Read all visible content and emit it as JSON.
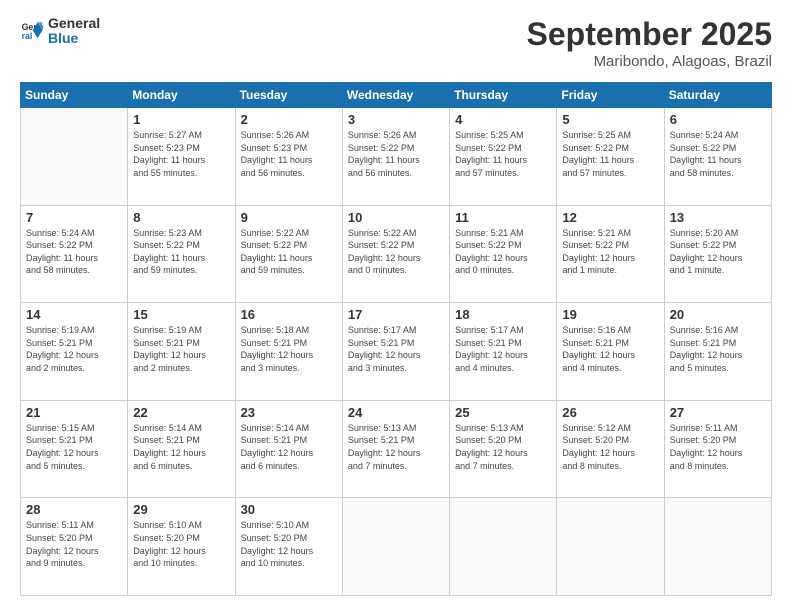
{
  "logo": {
    "line1": "General",
    "line2": "Blue"
  },
  "title": "September 2025",
  "location": "Maribondo, Alagoas, Brazil",
  "days_header": [
    "Sunday",
    "Monday",
    "Tuesday",
    "Wednesday",
    "Thursday",
    "Friday",
    "Saturday"
  ],
  "weeks": [
    [
      {
        "day": "",
        "info": ""
      },
      {
        "day": "1",
        "info": "Sunrise: 5:27 AM\nSunset: 5:23 PM\nDaylight: 11 hours\nand 55 minutes."
      },
      {
        "day": "2",
        "info": "Sunrise: 5:26 AM\nSunset: 5:23 PM\nDaylight: 11 hours\nand 56 minutes."
      },
      {
        "day": "3",
        "info": "Sunrise: 5:26 AM\nSunset: 5:22 PM\nDaylight: 11 hours\nand 56 minutes."
      },
      {
        "day": "4",
        "info": "Sunrise: 5:25 AM\nSunset: 5:22 PM\nDaylight: 11 hours\nand 57 minutes."
      },
      {
        "day": "5",
        "info": "Sunrise: 5:25 AM\nSunset: 5:22 PM\nDaylight: 11 hours\nand 57 minutes."
      },
      {
        "day": "6",
        "info": "Sunrise: 5:24 AM\nSunset: 5:22 PM\nDaylight: 11 hours\nand 58 minutes."
      }
    ],
    [
      {
        "day": "7",
        "info": "Sunrise: 5:24 AM\nSunset: 5:22 PM\nDaylight: 11 hours\nand 58 minutes."
      },
      {
        "day": "8",
        "info": "Sunrise: 5:23 AM\nSunset: 5:22 PM\nDaylight: 11 hours\nand 59 minutes."
      },
      {
        "day": "9",
        "info": "Sunrise: 5:22 AM\nSunset: 5:22 PM\nDaylight: 11 hours\nand 59 minutes."
      },
      {
        "day": "10",
        "info": "Sunrise: 5:22 AM\nSunset: 5:22 PM\nDaylight: 12 hours\nand 0 minutes."
      },
      {
        "day": "11",
        "info": "Sunrise: 5:21 AM\nSunset: 5:22 PM\nDaylight: 12 hours\nand 0 minutes."
      },
      {
        "day": "12",
        "info": "Sunrise: 5:21 AM\nSunset: 5:22 PM\nDaylight: 12 hours\nand 1 minute."
      },
      {
        "day": "13",
        "info": "Sunrise: 5:20 AM\nSunset: 5:22 PM\nDaylight: 12 hours\nand 1 minute."
      }
    ],
    [
      {
        "day": "14",
        "info": "Sunrise: 5:19 AM\nSunset: 5:21 PM\nDaylight: 12 hours\nand 2 minutes."
      },
      {
        "day": "15",
        "info": "Sunrise: 5:19 AM\nSunset: 5:21 PM\nDaylight: 12 hours\nand 2 minutes."
      },
      {
        "day": "16",
        "info": "Sunrise: 5:18 AM\nSunset: 5:21 PM\nDaylight: 12 hours\nand 3 minutes."
      },
      {
        "day": "17",
        "info": "Sunrise: 5:17 AM\nSunset: 5:21 PM\nDaylight: 12 hours\nand 3 minutes."
      },
      {
        "day": "18",
        "info": "Sunrise: 5:17 AM\nSunset: 5:21 PM\nDaylight: 12 hours\nand 4 minutes."
      },
      {
        "day": "19",
        "info": "Sunrise: 5:16 AM\nSunset: 5:21 PM\nDaylight: 12 hours\nand 4 minutes."
      },
      {
        "day": "20",
        "info": "Sunrise: 5:16 AM\nSunset: 5:21 PM\nDaylight: 12 hours\nand 5 minutes."
      }
    ],
    [
      {
        "day": "21",
        "info": "Sunrise: 5:15 AM\nSunset: 5:21 PM\nDaylight: 12 hours\nand 5 minutes."
      },
      {
        "day": "22",
        "info": "Sunrise: 5:14 AM\nSunset: 5:21 PM\nDaylight: 12 hours\nand 6 minutes."
      },
      {
        "day": "23",
        "info": "Sunrise: 5:14 AM\nSunset: 5:21 PM\nDaylight: 12 hours\nand 6 minutes."
      },
      {
        "day": "24",
        "info": "Sunrise: 5:13 AM\nSunset: 5:21 PM\nDaylight: 12 hours\nand 7 minutes."
      },
      {
        "day": "25",
        "info": "Sunrise: 5:13 AM\nSunset: 5:20 PM\nDaylight: 12 hours\nand 7 minutes."
      },
      {
        "day": "26",
        "info": "Sunrise: 5:12 AM\nSunset: 5:20 PM\nDaylight: 12 hours\nand 8 minutes."
      },
      {
        "day": "27",
        "info": "Sunrise: 5:11 AM\nSunset: 5:20 PM\nDaylight: 12 hours\nand 8 minutes."
      }
    ],
    [
      {
        "day": "28",
        "info": "Sunrise: 5:11 AM\nSunset: 5:20 PM\nDaylight: 12 hours\nand 9 minutes."
      },
      {
        "day": "29",
        "info": "Sunrise: 5:10 AM\nSunset: 5:20 PM\nDaylight: 12 hours\nand 10 minutes."
      },
      {
        "day": "30",
        "info": "Sunrise: 5:10 AM\nSunset: 5:20 PM\nDaylight: 12 hours\nand 10 minutes."
      },
      {
        "day": "",
        "info": ""
      },
      {
        "day": "",
        "info": ""
      },
      {
        "day": "",
        "info": ""
      },
      {
        "day": "",
        "info": ""
      }
    ]
  ]
}
